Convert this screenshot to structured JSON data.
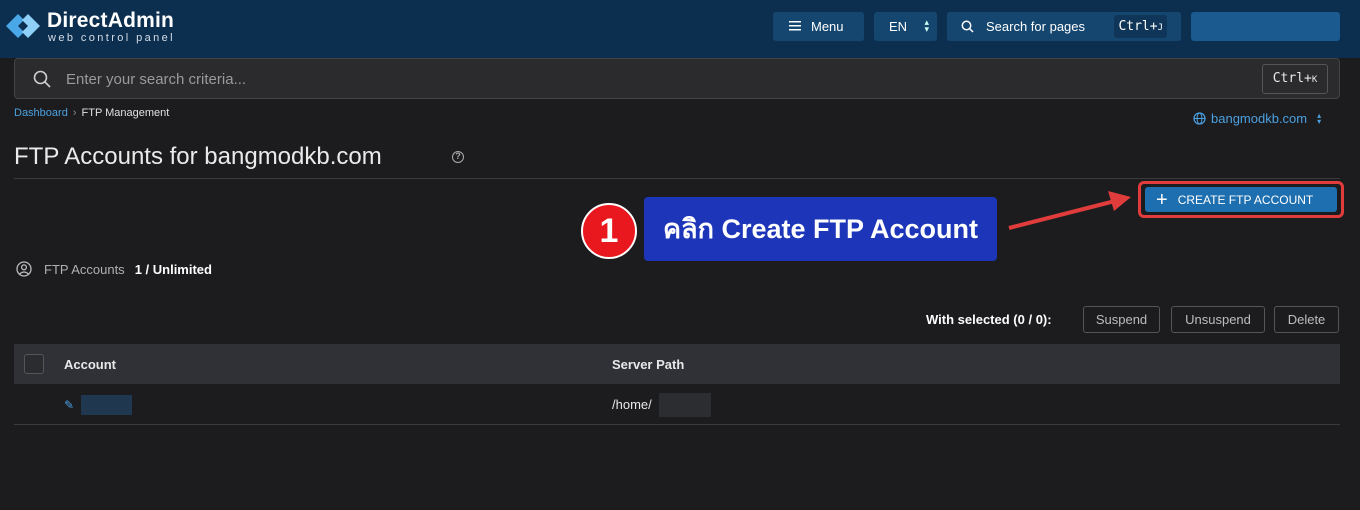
{
  "brand": {
    "title": "DirectAdmin",
    "subtitle": "web control panel"
  },
  "topbar": {
    "menu_label": "Menu",
    "lang_label": "EN",
    "search_label": "Search for pages",
    "search_shortcut_main": "Ctrl+",
    "search_shortcut_key": "J"
  },
  "search": {
    "placeholder": "Enter your search criteria...",
    "shortcut_main": "Ctrl+",
    "shortcut_key": "K"
  },
  "breadcrumb": {
    "root": "Dashboard",
    "current": "FTP Management"
  },
  "domain_select": {
    "value": "bangmodkb.com"
  },
  "page": {
    "title": "FTP Accounts for bangmodkb.com"
  },
  "actions": {
    "create_label": "CREATE FTP ACCOUNT"
  },
  "annotation": {
    "step": "1",
    "text": "คลิก Create FTP Account",
    "color": "#1d35b8"
  },
  "quota": {
    "label": "FTP Accounts",
    "value": "1 / Unlimited"
  },
  "bulk": {
    "with_selected": "With selected (0 / 0):",
    "suspend": "Suspend",
    "unsuspend": "Unsuspend",
    "delete": "Delete"
  },
  "table": {
    "columns": [
      "Account",
      "Server Path"
    ],
    "rows": [
      {
        "server_path_prefix": "/home/"
      }
    ]
  },
  "colors": {
    "topbar": "#0d2f4f",
    "accent": "#1e6fb0",
    "highlight": "#e03c3c"
  }
}
